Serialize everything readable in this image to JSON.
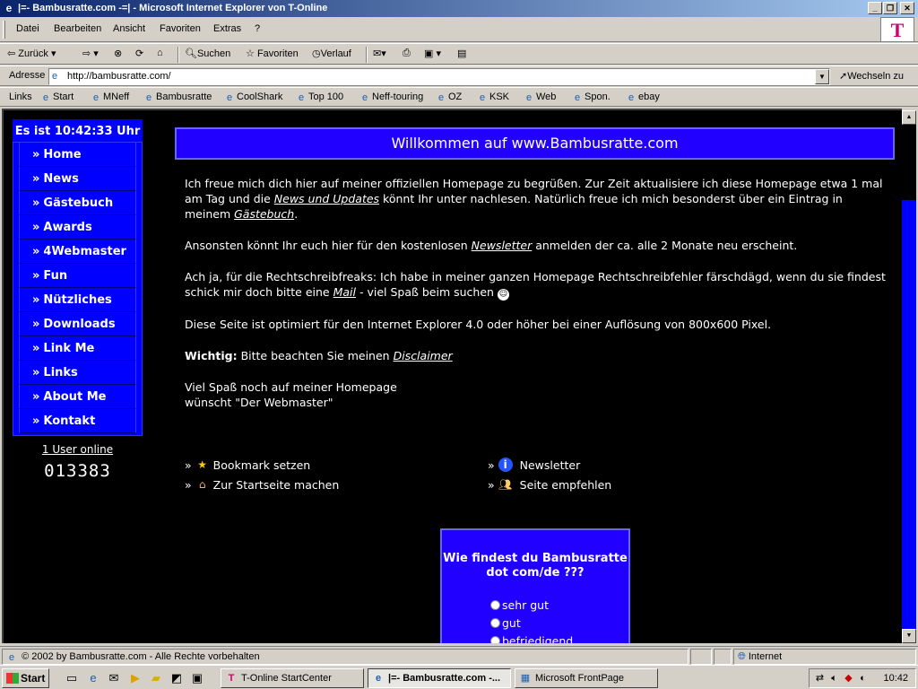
{
  "window": {
    "title": "|=- Bambusratte.com -=| - Microsoft Internet Explorer von T-Online",
    "min_glyph": "_",
    "max_glyph": "❐",
    "close_glyph": "✕"
  },
  "menubar": {
    "items": [
      "Datei",
      "Bearbeiten",
      "Ansicht",
      "Favoriten",
      "Extras",
      "?"
    ],
    "logo_text": "T"
  },
  "toolbar": {
    "back": "Zurück",
    "search": "Suchen",
    "favorites": "Favoriten",
    "history": "Verlauf"
  },
  "addressbar": {
    "label": "Adresse",
    "url": "http://bambusratte.com/",
    "go": "Wechseln zu"
  },
  "linksbar": {
    "label": "Links",
    "items": [
      "Start",
      "MNeff",
      "Bambusratte",
      "CoolShark",
      "Top 100",
      "Neff-touring",
      "OZ",
      "KSK",
      "Web",
      "Spon.",
      "ebay"
    ]
  },
  "sidebar": {
    "clock": "Es ist 10:42:33 Uhr",
    "nav_prefix": "»",
    "nav": [
      "Home",
      "News",
      "Gästebuch",
      "Awards",
      "4Webmaster",
      "Fun",
      "Nützliches",
      "Downloads",
      "Link Me",
      "Links",
      "About Me",
      "Kontakt"
    ],
    "users_online": "1 User online",
    "counter": "013383"
  },
  "main": {
    "banner": "Willkommen auf www.Bambusratte.com",
    "p1_a": "Ich freue mich dich hier auf meiner offiziellen Homepage zu begrüßen. Zur Zeit aktualisiere ich diese Homepage etwa 1 mal am Tag und die ",
    "p1_link1": "News und Updates",
    "p1_b": " könnt Ihr unter nachlesen. Natürlich freue ich mich besonderst über ein Eintrag in meinem ",
    "p1_link2": "Gästebuch",
    "p1_c": ".",
    "p2_a": "Ansonsten könnt Ihr euch hier für den kostenlosen ",
    "p2_link": "Newsletter",
    "p2_b": " anmelden der ca. alle 2 Monate neu erscheint.",
    "p3_a": "Ach ja, für die Rechtschreibfreaks: Ich habe in meiner ganzen Homepage Rechtschreibfehler färschdägd, wenn du sie findest schick mir doch bitte eine ",
    "p3_link": "Mail",
    "p3_b": " - viel Spaß beim suchen",
    "p4": "Diese Seite ist optimiert für den Internet Explorer 4.0 oder höher bei einer Auflösung von 800x600 Pixel.",
    "p5_bold": "Wichtig:",
    "p5_a": " Bitte beachten Sie meinen ",
    "p5_link": "Disclaimer",
    "p6_line1": "Viel Spaß noch auf meiner Homepage",
    "p6_line2": "wünscht \"Der Webmaster\""
  },
  "actions": {
    "prefix": "»",
    "bookmark": "Bookmark setzen",
    "startpage": "Zur Startseite machen",
    "newsletter": "Newsletter",
    "recommend": "Seite empfehlen"
  },
  "poll": {
    "question": "Wie findest du Bambusratte dot com/de ???",
    "options": [
      "sehr gut",
      "gut",
      "befriedigend"
    ]
  },
  "statusbar": {
    "text": "© 2002 by Bambusratte.com - Alle Rechte vorbehalten",
    "zone": "Internet"
  },
  "taskbar": {
    "start": "Start",
    "tasks": [
      "T-Online StartCenter",
      "|=- Bambusratte.com -...",
      "Microsoft FrontPage"
    ],
    "clock": "10:42"
  },
  "colors": {
    "page_bg": "#000000",
    "nav_blue": "#0000ff",
    "banner_blue": "#2200ff"
  }
}
